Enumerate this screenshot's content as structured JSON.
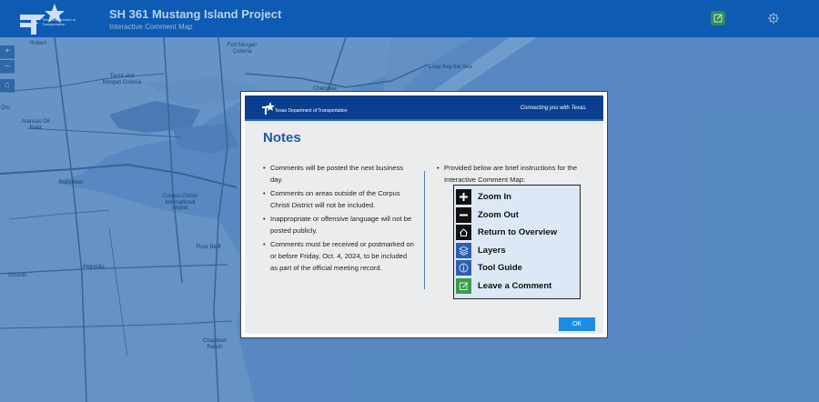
{
  "header": {
    "title": "SH 361 Mustang Island Project",
    "subtitle": "Interactive Comment Map",
    "logo_text": "Texas Department of Transportation",
    "comment_icon": "comment-edit-icon",
    "gear_icon": "gear-icon"
  },
  "map": {
    "labels": [
      "Robert",
      "Tierra and Morgan Colonia",
      "Fort Morgan Colonia",
      "Loop Key the Sea",
      "Cherokee",
      "Aransas Oil Field",
      "Robstown",
      "Corpus Christi International Airport",
      "Flour Bluff",
      "Driscoll",
      "Petronila",
      "Chapman Ranch",
      "Oro"
    ],
    "controls": [
      "+",
      "–",
      "⌂"
    ]
  },
  "modal": {
    "banner_name": "Texas Department of Transportation",
    "banner_tagline": "Connecting you with Texas.",
    "title": "Notes",
    "left_items": [
      "Comments will be posted the next business day.",
      "Comments on areas outside of the Corpus Christi District will not be included.",
      "Inappropriate or offensive language will not be posted publicly.",
      "Comments must be received or postmarked on or before Friday, Oct. 4, 2024, to be included as part of the official meeting record."
    ],
    "right_intro": "Provided below are brief instructions for the Interactive Comment Map:",
    "guide": [
      {
        "label": "Zoom In",
        "icon": "plus-icon"
      },
      {
        "label": "Zoom Out",
        "icon": "minus-icon"
      },
      {
        "label": "Return to Overview",
        "icon": "home-icon"
      },
      {
        "label": "Layers",
        "icon": "layers-icon"
      },
      {
        "label": "Tool Guide",
        "icon": "info-icon"
      },
      {
        "label": "Leave a Comment",
        "icon": "comment-edit-icon"
      }
    ],
    "ok_label": "OK"
  },
  "colors": {
    "header": "#0d5bb2",
    "map_water": "#5e8fc6",
    "modal_title": "#1b5aa8",
    "ok_button": "#1a8ee6",
    "comment_green": "#2e8b5a"
  }
}
